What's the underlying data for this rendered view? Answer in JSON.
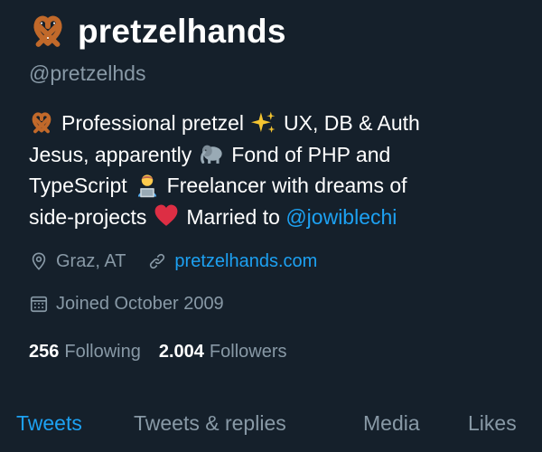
{
  "profile": {
    "display_name": "pretzelhands",
    "handle": "@pretzelhds",
    "bio": {
      "seg1": "Professional pretzel",
      "seg2": "UX, DB & Auth",
      "seg3": "Jesus, apparently",
      "seg4": "Fond of PHP and",
      "seg5": "TypeScript",
      "seg6": "Freelancer with dreams of",
      "seg7": "side-projects",
      "seg8": "Married to",
      "mention": "@jowiblechi"
    },
    "location": "Graz, AT",
    "website": "pretzelhands.com",
    "joined": "Joined October 2009"
  },
  "stats": {
    "following_count": "256",
    "following_label": "Following",
    "followers_count": "2.004",
    "followers_label": "Followers"
  },
  "tabs": {
    "tweets": "Tweets",
    "replies": "Tweets & replies",
    "media": "Media",
    "likes": "Likes"
  },
  "icons": {
    "name_emoji": "pretzel-icon",
    "bio_emojis": [
      "pretzel-icon",
      "sparkles-icon",
      "elephant-icon",
      "technologist-icon",
      "heart-icon"
    ],
    "meta": [
      "location-pin-icon",
      "link-icon",
      "calendar-icon"
    ]
  },
  "colors": {
    "background": "#15202b",
    "text": "#ffffff",
    "secondary": "#8899a6",
    "accent": "#1da1f2"
  }
}
